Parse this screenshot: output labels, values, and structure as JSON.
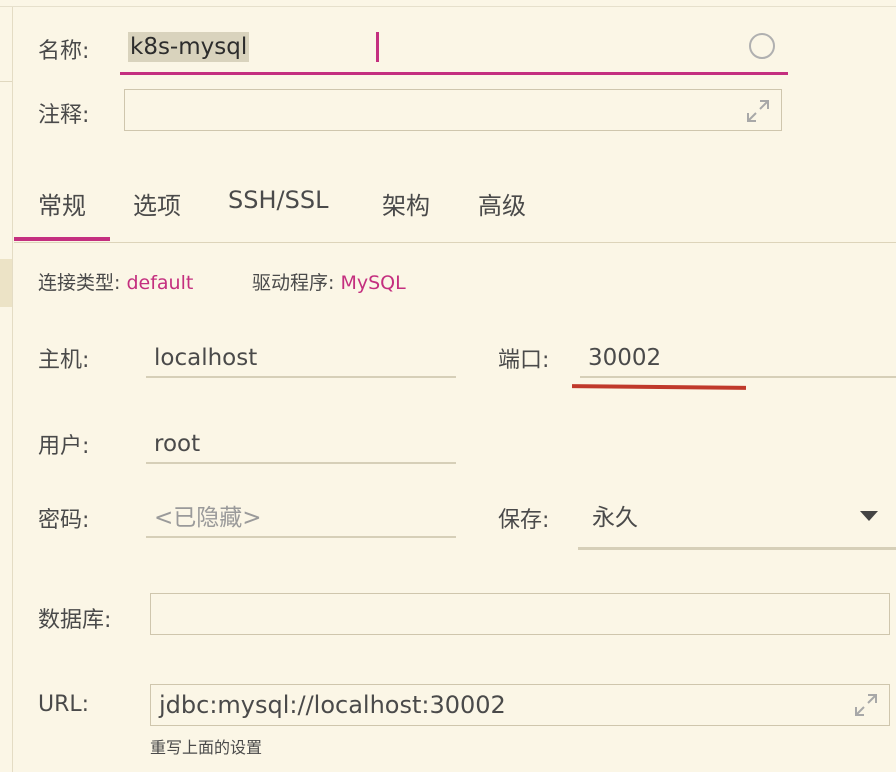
{
  "name": {
    "label": "名称:",
    "value": "k8s-mysql"
  },
  "comment": {
    "label": "注释:",
    "value": ""
  },
  "tabs": [
    {
      "label": "常规",
      "active": true
    },
    {
      "label": "选项",
      "active": false
    },
    {
      "label": "SSH/SSL",
      "active": false
    },
    {
      "label": "架构",
      "active": false
    },
    {
      "label": "高级",
      "active": false
    }
  ],
  "connection": {
    "type_label": "连接类型:",
    "type_value": "default",
    "driver_label": "驱动程序:",
    "driver_value": "MySQL"
  },
  "host": {
    "label": "主机:",
    "value": "localhost"
  },
  "port": {
    "label": "端口:",
    "value": "30002"
  },
  "user": {
    "label": "用户:",
    "value": "root"
  },
  "password": {
    "label": "密码:",
    "placeholder": "<已隐藏>"
  },
  "save": {
    "label": "保存:",
    "value": "永久"
  },
  "database": {
    "label": "数据库:",
    "value": ""
  },
  "url": {
    "label": "URL:",
    "value": "jdbc:mysql://localhost:30002",
    "hint": "重写上面的设置"
  },
  "colors": {
    "accent": "#c42f7f",
    "annotation": "#c0392b",
    "background": "#fbf6e6"
  }
}
